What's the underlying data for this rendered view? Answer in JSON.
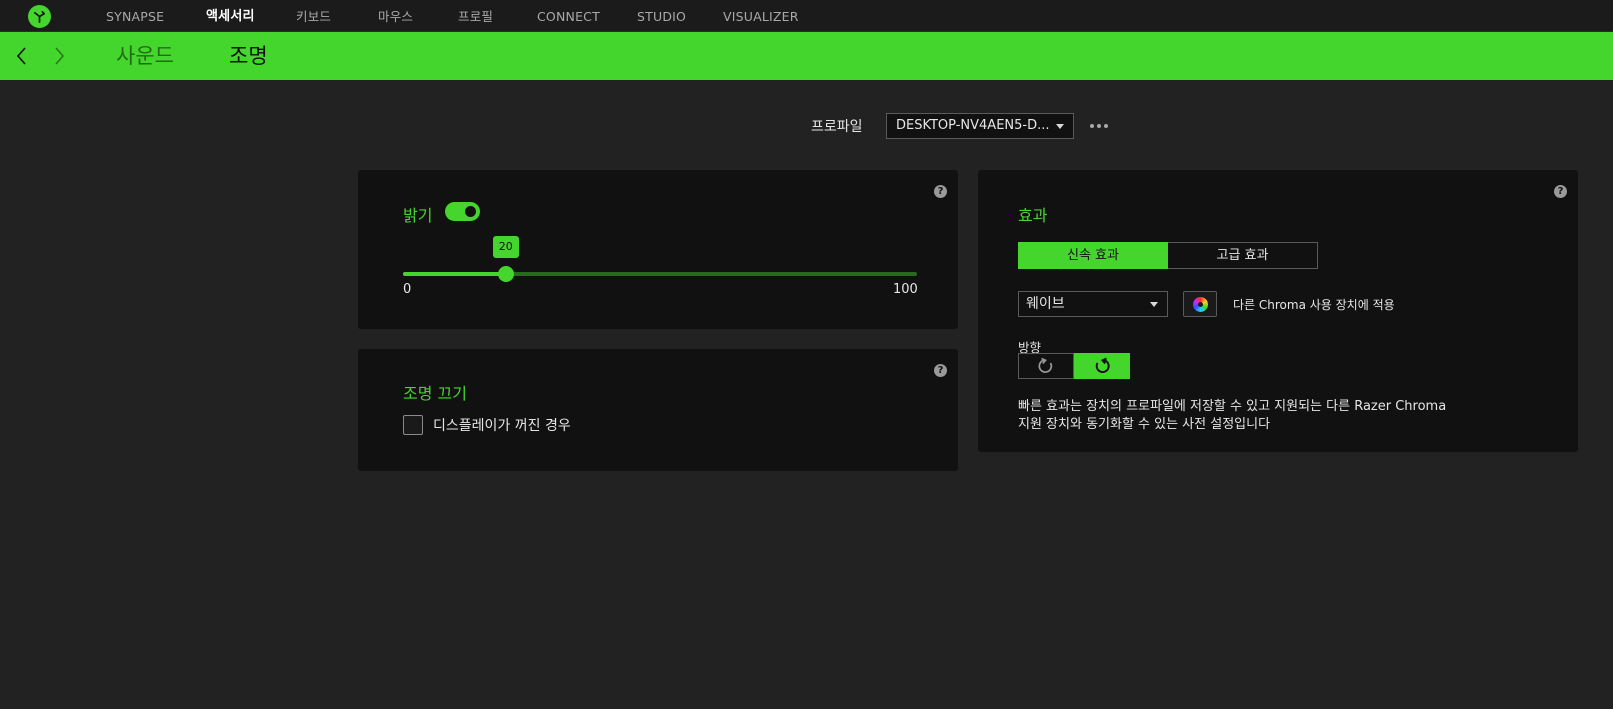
{
  "nav": {
    "items": [
      {
        "label": "SYNAPSE",
        "active": false
      },
      {
        "label": "액세서리",
        "active": true
      },
      {
        "label": "키보드",
        "active": false
      },
      {
        "label": "마우스",
        "active": false
      },
      {
        "label": "프로필",
        "active": false
      },
      {
        "label": "CONNECT",
        "active": false
      },
      {
        "label": "STUDIO",
        "active": false
      },
      {
        "label": "VISUALIZER",
        "active": false
      }
    ],
    "logo_icon": "razer-logo-icon"
  },
  "subnav": {
    "tabs": [
      {
        "label": "사운드",
        "active": false
      },
      {
        "label": "조명",
        "active": true
      }
    ]
  },
  "profile": {
    "label": "프로파일",
    "value": "DESKTOP-NV4AEN5-D..."
  },
  "brightness": {
    "title": "밝기",
    "enabled": true,
    "value": 20,
    "min": 0,
    "max": 100,
    "min_label": "0",
    "max_label": "100",
    "value_label": "20"
  },
  "lighting_off": {
    "title": "조명 끄기",
    "checkbox_label": "디스플레이가 꺼진 경우",
    "checked": false
  },
  "effects": {
    "title": "효과",
    "tabs": [
      {
        "label": "신속 효과",
        "active": true
      },
      {
        "label": "고급 효과",
        "active": false
      }
    ],
    "selected_effect": "웨이브",
    "chroma_apply_label": "다른 Chroma 사용 장치에 적용",
    "direction_label": "방향",
    "description": "빠른 효과는 장치의 프로파일에 저장할 수 있고 지원되는 다른 Razer Chroma 지원 장치와 동기화할 수 있는 사전 설정입니다"
  },
  "help_glyph": "?",
  "colors": {
    "accent": "#44d62c",
    "background": "#222222",
    "panel": "#111111",
    "topbar": "#1b1b1b"
  }
}
